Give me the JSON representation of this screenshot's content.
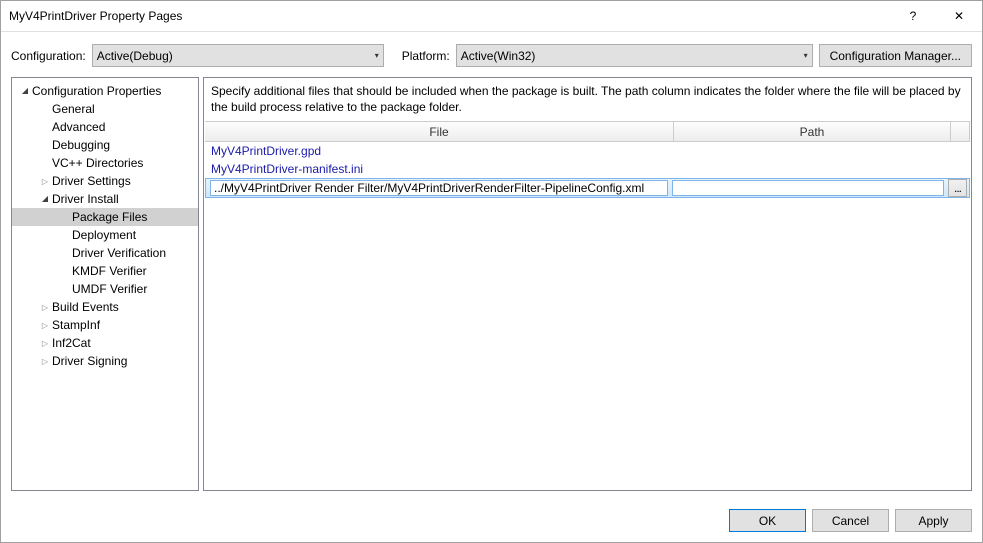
{
  "window": {
    "title": "MyV4PrintDriver Property Pages",
    "help": "?",
    "close": "✕"
  },
  "configRow": {
    "configurationLabel": "Configuration:",
    "configurationValue": "Active(Debug)",
    "platformLabel": "Platform:",
    "platformValue": "Active(Win32)",
    "configurationManager": "Configuration Manager..."
  },
  "tree": {
    "root": "Configuration Properties",
    "general": "General",
    "advanced": "Advanced",
    "debugging": "Debugging",
    "vcpp": "VC++ Directories",
    "driverSettings": "Driver Settings",
    "driverInstall": "Driver Install",
    "packageFiles": "Package Files",
    "deployment": "Deployment",
    "driverVerification": "Driver Verification",
    "kmdf": "KMDF Verifier",
    "umdf": "UMDF Verifier",
    "buildEvents": "Build Events",
    "stampInf": "StampInf",
    "inf2cat": "Inf2Cat",
    "driverSigning": "Driver Signing"
  },
  "panel": {
    "description": "Specify additional files that should be included when the package is built.  The path column indicates the folder where the file will be placed by the build process relative to the package folder.",
    "headerFile": "File",
    "headerPath": "Path",
    "rows": [
      {
        "file": "MyV4PrintDriver.gpd",
        "path": ""
      },
      {
        "file": "MyV4PrintDriver-manifest.ini",
        "path": ""
      }
    ],
    "editingRow": {
      "file": "../MyV4PrintDriver Render Filter/MyV4PrintDriverRenderFilter-PipelineConfig.xml",
      "path": ""
    },
    "browse": "..."
  },
  "footer": {
    "ok": "OK",
    "cancel": "Cancel",
    "apply": "Apply"
  }
}
